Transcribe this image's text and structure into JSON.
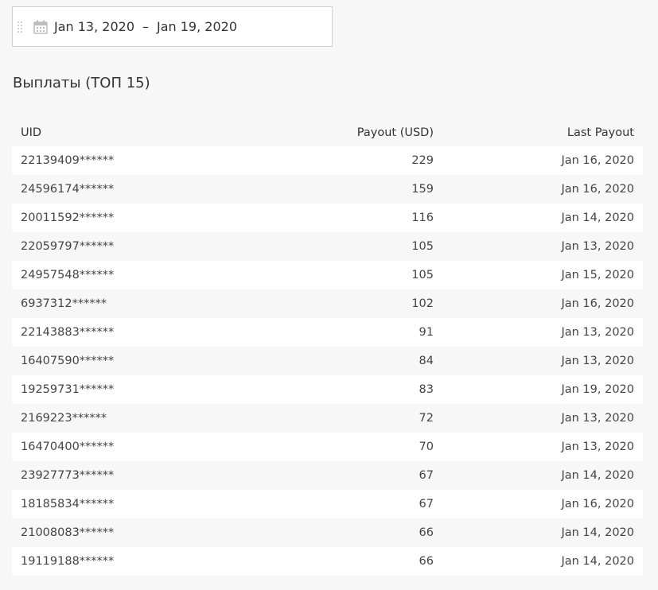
{
  "date_range": {
    "start": "Jan 13, 2020",
    "separator": "–",
    "end": "Jan 19, 2020",
    "icon": "calendar-icon"
  },
  "section": {
    "title": "Выплаты (ТОП 15)"
  },
  "table": {
    "headers": {
      "uid": "UID",
      "payout": "Payout (USD)",
      "last_payout": "Last Payout"
    },
    "rows": [
      {
        "uid": "22139409******",
        "payout": "229",
        "last_payout": "Jan 16, 2020"
      },
      {
        "uid": "24596174******",
        "payout": "159",
        "last_payout": "Jan 16, 2020"
      },
      {
        "uid": "20011592******",
        "payout": "116",
        "last_payout": "Jan 14, 2020"
      },
      {
        "uid": "22059797******",
        "payout": "105",
        "last_payout": "Jan 13, 2020"
      },
      {
        "uid": "24957548******",
        "payout": "105",
        "last_payout": "Jan 15, 2020"
      },
      {
        "uid": "6937312******",
        "payout": "102",
        "last_payout": "Jan 16, 2020"
      },
      {
        "uid": "22143883******",
        "payout": "91",
        "last_payout": "Jan 13, 2020"
      },
      {
        "uid": "16407590******",
        "payout": "84",
        "last_payout": "Jan 13, 2020"
      },
      {
        "uid": "19259731******",
        "payout": "83",
        "last_payout": "Jan 19, 2020"
      },
      {
        "uid": "2169223******",
        "payout": "72",
        "last_payout": "Jan 13, 2020"
      },
      {
        "uid": "16470400******",
        "payout": "70",
        "last_payout": "Jan 13, 2020"
      },
      {
        "uid": "23927773******",
        "payout": "67",
        "last_payout": "Jan 14, 2020"
      },
      {
        "uid": "18185834******",
        "payout": "67",
        "last_payout": "Jan 16, 2020"
      },
      {
        "uid": "21008083******",
        "payout": "66",
        "last_payout": "Jan 14, 2020"
      },
      {
        "uid": "19119188******",
        "payout": "66",
        "last_payout": "Jan 14, 2020"
      }
    ]
  },
  "colors": {
    "background": "#f7f7f7",
    "row_alt": "#ffffff",
    "text": "#333333",
    "border": "#cfcfcf"
  }
}
